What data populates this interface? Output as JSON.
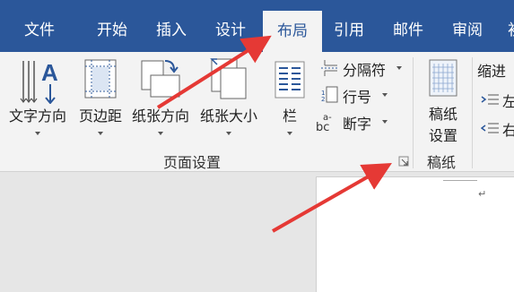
{
  "tabs": [
    {
      "label": "文件"
    },
    {
      "label": "开始"
    },
    {
      "label": "插入"
    },
    {
      "label": "设计"
    },
    {
      "label": "布局"
    },
    {
      "label": "引用"
    },
    {
      "label": "邮件"
    },
    {
      "label": "审阅"
    },
    {
      "label": "初"
    }
  ],
  "active_tab": "布局",
  "page_setup": {
    "text_direction": "文字方向",
    "margins": "页边距",
    "orientation": "纸张方向",
    "size": "纸张大小",
    "columns": "栏",
    "breaks": "分隔符",
    "line_numbers": "行号",
    "hyphenation": "断字",
    "group_label": "页面设置"
  },
  "manuscript": {
    "button_line1": "稿纸",
    "button_line2": "设置",
    "group_label": "稿纸"
  },
  "paragraph": {
    "indent_label": "缩进",
    "left_label": "左",
    "right_label": "右"
  },
  "document": {
    "paragraph_mark": "↵"
  },
  "colors": {
    "ribbon_blue": "#2b579a",
    "ribbon_bg": "#f3f3f3",
    "arrow_red": "#e53935"
  }
}
